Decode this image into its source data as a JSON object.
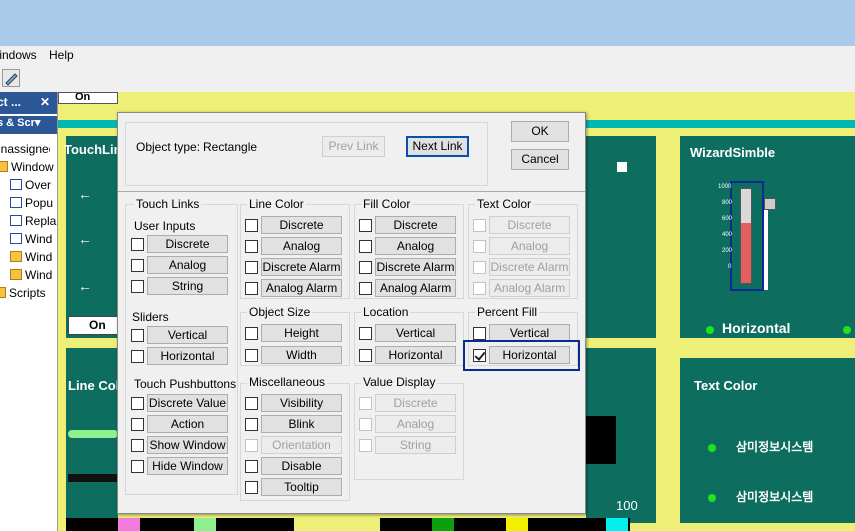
{
  "menu": {
    "windows": "Windows",
    "help": "Help"
  },
  "tree": {
    "header": "ct ...",
    "tab": "s & Scr",
    "items": [
      "Unassigned",
      "Window",
      "Over",
      "Popu",
      "Repla",
      "Wind",
      "Wind",
      "Wind",
      "Scripts"
    ]
  },
  "canvas": {
    "top_button": "On",
    "touch_links": "TouchLin",
    "on_button": "On",
    "line_color": "Line Col",
    "wizard_title": "WizardSimble",
    "horizontal_label": "Horizontal",
    "text_color_title": "Text Color",
    "korean_1": "삼미정보시스템",
    "korean_2": "삼미정보시스템",
    "value_100": "100",
    "scale": [
      "1000",
      "800",
      "600",
      "400",
      "200",
      "0"
    ]
  },
  "dialog": {
    "object_type_label": "Object type:",
    "object_type_value": "Rectangle",
    "prev_link": "Prev Link",
    "next_link": "Next Link",
    "ok": "OK",
    "cancel": "Cancel",
    "touch_links": "Touch Links",
    "user_inputs": "User Inputs",
    "ui_discrete": "Discrete",
    "ui_analog": "Analog",
    "ui_string": "String",
    "sliders": "Sliders",
    "sl_vertical": "Vertical",
    "sl_horizontal": "Horizontal",
    "touch_pushbuttons": "Touch Pushbuttons",
    "tp_discrete_value": "Discrete Value",
    "tp_action": "Action",
    "tp_show_window": "Show Window",
    "tp_hide_window": "Hide Window",
    "line_color": "Line Color",
    "lc_discrete": "Discrete",
    "lc_analog": "Analog",
    "lc_discrete_alarm": "Discrete Alarm",
    "lc_analog_alarm": "Analog Alarm",
    "fill_color": "Fill Color",
    "fc_discrete": "Discrete",
    "fc_analog": "Analog",
    "fc_discrete_alarm": "Discrete Alarm",
    "fc_analog_alarm": "Analog Alarm",
    "text_color": "Text Color",
    "txc_discrete": "Discrete",
    "txc_analog": "Analog",
    "txc_discrete_alarm": "Discrete Alarm",
    "txc_analog_alarm": "Analog Alarm",
    "object_size": "Object Size",
    "os_height": "Height",
    "os_width": "Width",
    "location": "Location",
    "loc_vertical": "Vertical",
    "loc_horizontal": "Horizontal",
    "percent_fill": "Percent Fill",
    "pf_vertical": "Vertical",
    "pf_horizontal": "Horizontal",
    "miscellaneous": "Miscellaneous",
    "m_visibility": "Visibility",
    "m_blink": "Blink",
    "m_orientation": "Orientation",
    "m_disable": "Disable",
    "m_tooltip": "Tooltip",
    "value_display": "Value Display",
    "vd_discrete": "Discrete",
    "vd_analog": "Analog",
    "vd_string": "String"
  },
  "colors": {
    "teal": "#0d6e5f",
    "yellow": "#eeef77",
    "cyan": "#00b8b0",
    "highlight": "#0b2c8f"
  }
}
